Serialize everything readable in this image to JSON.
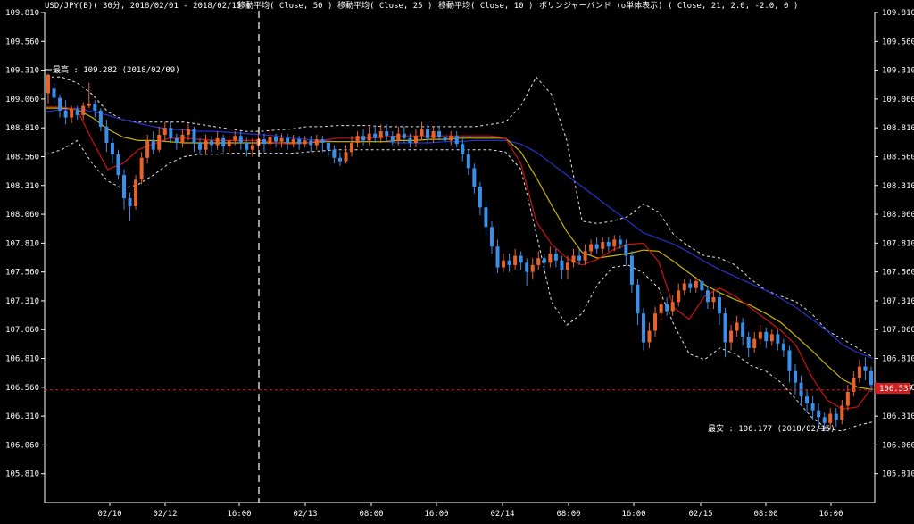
{
  "header": {
    "symbol": "USD/JPY(B)( 30分, 2018/02/01 - 2018/02/15 )",
    "ma50": "移動平均( Close, 50 )",
    "ma25": "移動平均( Close, 25 )",
    "ma10": "移動平均( Close, 10 )",
    "bb": "ボリンジャーバンド (σ単体表示) ( Close, 21, 2.0, -2.0, 0 )"
  },
  "annotations": {
    "high": "最高 : 109.282 (2018/02/09)",
    "low": "最安 : 106.177 (2018/02/15)",
    "current": "106.537"
  },
  "colors": {
    "up": "#e8632c",
    "down": "#3a8fe8",
    "ma50": "#2233cc",
    "ma25": "#c8b400",
    "ma10": "#cc1111",
    "band": "#e6e6e6",
    "grid": "#2a2a2a",
    "current_line": "#d02020"
  },
  "chart_data": {
    "type": "line",
    "title": "USD/JPY(B)( 30分, 2018/02/01 - 2018/02/15 )",
    "ylim": [
      105.56,
      109.81
    ],
    "y_ticks": [
      109.81,
      109.56,
      109.31,
      109.06,
      108.81,
      108.56,
      108.31,
      108.06,
      107.81,
      107.56,
      107.31,
      107.06,
      106.81,
      106.56,
      106.31,
      106.06,
      105.81
    ],
    "x_ticks": [
      "02/10",
      "02/12",
      "16:00",
      "02/13",
      "08:00",
      "16:00",
      "02/14",
      "08:00",
      "16:00",
      "02/15",
      "08:00",
      "16:00"
    ],
    "grid": true,
    "current_price": 106.537,
    "high": 109.282,
    "low": 106.177,
    "series": [
      {
        "name": "移動平均( Close, 50 )",
        "values": [
          108.95,
          108.97,
          108.98,
          108.95,
          108.92,
          108.88,
          108.85,
          108.82,
          108.8,
          108.79,
          108.78,
          108.78,
          108.77,
          108.76,
          108.75,
          108.74,
          108.72,
          108.71,
          108.7,
          108.69,
          108.69,
          108.69,
          108.69,
          108.68,
          108.68,
          108.68,
          108.69,
          108.69,
          108.7,
          108.7,
          108.7,
          108.67,
          108.6,
          108.5,
          108.4,
          108.3,
          108.2,
          108.1,
          108.0,
          107.9,
          107.85,
          107.8,
          107.73,
          107.65,
          107.58,
          107.52,
          107.46,
          107.4,
          107.33,
          107.25,
          107.15,
          107.05,
          106.93,
          106.86,
          106.81
        ]
      },
      {
        "name": "移動平均( Close, 25 )",
        "values": [
          108.98,
          108.98,
          108.97,
          108.9,
          108.8,
          108.73,
          108.7,
          108.7,
          108.69,
          108.68,
          108.68,
          108.68,
          108.68,
          108.68,
          108.68,
          108.68,
          108.68,
          108.68,
          108.69,
          108.69,
          108.69,
          108.69,
          108.69,
          108.7,
          108.7,
          108.71,
          108.71,
          108.72,
          108.72,
          108.72,
          108.72,
          108.6,
          108.38,
          108.14,
          107.91,
          107.73,
          107.68,
          107.7,
          107.72,
          107.75,
          107.74,
          107.65,
          107.55,
          107.45,
          107.38,
          107.32,
          107.27,
          107.2,
          107.12,
          107.0,
          106.88,
          106.75,
          106.63,
          106.56,
          106.54
        ]
      },
      {
        "name": "移動平均( Close, 10 )",
        "values": [
          108.99,
          108.99,
          108.97,
          108.7,
          108.45,
          108.5,
          108.62,
          108.67,
          108.72,
          108.72,
          108.71,
          108.7,
          108.7,
          108.7,
          108.7,
          108.68,
          108.67,
          108.68,
          108.7,
          108.72,
          108.72,
          108.72,
          108.73,
          108.74,
          108.74,
          108.74,
          108.74,
          108.74,
          108.74,
          108.74,
          108.72,
          108.5,
          108.0,
          107.8,
          107.68,
          107.62,
          107.67,
          107.75,
          107.8,
          107.81,
          107.65,
          107.25,
          107.15,
          107.35,
          107.42,
          107.35,
          107.25,
          107.15,
          107.05,
          106.92,
          106.65,
          106.45,
          106.37,
          106.39,
          106.57
        ]
      },
      {
        "name": "BB+2σ",
        "values": [
          109.25,
          109.25,
          109.2,
          109.1,
          108.95,
          108.88,
          108.86,
          108.86,
          108.86,
          108.86,
          108.84,
          108.82,
          108.8,
          108.78,
          108.78,
          108.79,
          108.8,
          108.82,
          108.82,
          108.83,
          108.83,
          108.83,
          108.82,
          108.82,
          108.82,
          108.82,
          108.82,
          108.82,
          108.82,
          108.84,
          108.86,
          109.0,
          109.25,
          109.1,
          108.7,
          108.0,
          107.98,
          108.0,
          108.04,
          108.15,
          108.08,
          107.88,
          107.78,
          107.7,
          107.68,
          107.62,
          107.5,
          107.4,
          107.35,
          107.3,
          107.2,
          107.05,
          106.98,
          106.9,
          106.82
        ]
      },
      {
        "name": "BB-2σ",
        "values": [
          108.58,
          108.62,
          108.7,
          108.5,
          108.35,
          108.28,
          108.32,
          108.4,
          108.5,
          108.56,
          108.58,
          108.58,
          108.59,
          108.59,
          108.59,
          108.59,
          108.59,
          108.6,
          108.61,
          108.62,
          108.62,
          108.62,
          108.62,
          108.62,
          108.62,
          108.62,
          108.62,
          108.62,
          108.62,
          108.62,
          108.6,
          108.45,
          107.9,
          107.3,
          107.1,
          107.2,
          107.45,
          107.6,
          107.62,
          107.55,
          107.42,
          107.1,
          106.85,
          106.8,
          106.9,
          106.85,
          106.75,
          106.7,
          106.6,
          106.45,
          106.3,
          106.2,
          106.18,
          106.23,
          106.26
        ]
      }
    ],
    "candles": [
      [
        109.11,
        109.27,
        109.28,
        109.02
      ],
      [
        109.15,
        109.07,
        109.2,
        109.02
      ],
      [
        109.07,
        108.96,
        109.1,
        108.9
      ],
      [
        108.96,
        108.9,
        109.05,
        108.84
      ],
      [
        108.9,
        108.97,
        109.0,
        108.85
      ],
      [
        108.97,
        108.92,
        109.0,
        108.88
      ],
      [
        108.92,
        109.0,
        109.03,
        108.88
      ],
      [
        109.0,
        109.02,
        109.2,
        108.98
      ],
      [
        109.02,
        108.96,
        109.05,
        108.9
      ],
      [
        108.96,
        108.82,
        108.98,
        108.78
      ],
      [
        108.82,
        108.68,
        108.88,
        108.6
      ],
      [
        108.68,
        108.58,
        108.72,
        108.5
      ],
      [
        108.58,
        108.4,
        108.62,
        108.36
      ],
      [
        108.4,
        108.2,
        108.45,
        108.1
      ],
      [
        108.2,
        108.13,
        108.25,
        108.0
      ],
      [
        108.13,
        108.36,
        108.4,
        108.1
      ],
      [
        108.36,
        108.55,
        108.6,
        108.32
      ],
      [
        108.55,
        108.7,
        108.75,
        108.5
      ],
      [
        108.7,
        108.62,
        108.78,
        108.58
      ],
      [
        108.62,
        108.75,
        108.82,
        108.6
      ],
      [
        108.75,
        108.81,
        108.86,
        108.7
      ],
      [
        108.81,
        108.72,
        108.86,
        108.68
      ],
      [
        108.72,
        108.68,
        108.76,
        108.62
      ],
      [
        108.68,
        108.75,
        108.8,
        108.64
      ],
      [
        108.75,
        108.8,
        108.85,
        108.7
      ],
      [
        108.8,
        108.68,
        108.82,
        108.6
      ],
      [
        108.68,
        108.62,
        108.72,
        108.58
      ],
      [
        108.62,
        108.7,
        108.75,
        108.58
      ],
      [
        108.7,
        108.66,
        108.74,
        108.6
      ],
      [
        108.66,
        108.72,
        108.78,
        108.62
      ],
      [
        108.72,
        108.65,
        108.75,
        108.6
      ],
      [
        108.65,
        108.7,
        108.74,
        108.6
      ],
      [
        108.7,
        108.74,
        108.78,
        108.66
      ],
      [
        108.74,
        108.68,
        108.78,
        108.62
      ],
      [
        108.68,
        108.62,
        108.72,
        108.56
      ],
      [
        108.62,
        108.66,
        108.72,
        108.56
      ],
      [
        108.66,
        108.71,
        108.76,
        108.62
      ],
      [
        108.71,
        108.67,
        108.76,
        108.6
      ],
      [
        108.67,
        108.73,
        108.78,
        108.62
      ],
      [
        108.73,
        108.69,
        108.76,
        108.64
      ],
      [
        108.69,
        108.72,
        108.76,
        108.64
      ],
      [
        108.72,
        108.68,
        108.76,
        108.62
      ],
      [
        108.68,
        108.71,
        108.75,
        108.64
      ],
      [
        108.71,
        108.67,
        108.74,
        108.62
      ],
      [
        108.67,
        108.7,
        108.74,
        108.64
      ],
      [
        108.7,
        108.66,
        108.74,
        108.6
      ],
      [
        108.66,
        108.71,
        108.75,
        108.62
      ],
      [
        108.71,
        108.68,
        108.74,
        108.6
      ],
      [
        108.68,
        108.62,
        108.7,
        108.56
      ],
      [
        108.62,
        108.55,
        108.66,
        108.5
      ],
      [
        108.55,
        108.52,
        108.6,
        108.48
      ],
      [
        108.52,
        108.6,
        108.66,
        108.5
      ],
      [
        108.6,
        108.68,
        108.74,
        108.56
      ],
      [
        108.68,
        108.74,
        108.78,
        108.64
      ],
      [
        108.74,
        108.7,
        108.8,
        108.66
      ],
      [
        108.7,
        108.76,
        108.82,
        108.66
      ],
      [
        108.76,
        108.72,
        108.82,
        108.68
      ],
      [
        108.72,
        108.78,
        108.84,
        108.68
      ],
      [
        108.78,
        108.74,
        108.84,
        108.7
      ],
      [
        108.74,
        108.7,
        108.78,
        108.66
      ],
      [
        108.7,
        108.76,
        108.82,
        108.66
      ],
      [
        108.76,
        108.72,
        108.82,
        108.68
      ],
      [
        108.72,
        108.68,
        108.76,
        108.64
      ],
      [
        108.68,
        108.74,
        108.8,
        108.64
      ],
      [
        108.74,
        108.8,
        108.86,
        108.7
      ],
      [
        108.8,
        108.72,
        108.84,
        108.68
      ],
      [
        108.72,
        108.78,
        108.82,
        108.68
      ],
      [
        108.78,
        108.73,
        108.82,
        108.7
      ],
      [
        108.73,
        108.7,
        108.76,
        108.66
      ],
      [
        108.7,
        108.74,
        108.78,
        108.66
      ],
      [
        108.74,
        108.67,
        108.78,
        108.64
      ],
      [
        108.67,
        108.58,
        108.72,
        108.52
      ],
      [
        108.58,
        108.46,
        108.62,
        108.4
      ],
      [
        108.46,
        108.3,
        108.5,
        108.24
      ],
      [
        108.3,
        108.12,
        108.34,
        108.05
      ],
      [
        108.12,
        107.95,
        108.18,
        107.88
      ],
      [
        107.95,
        107.78,
        108.0,
        107.72
      ],
      [
        107.78,
        107.6,
        107.84,
        107.55
      ],
      [
        107.6,
        107.66,
        107.72,
        107.56
      ],
      [
        107.66,
        107.62,
        107.72,
        107.56
      ],
      [
        107.62,
        107.7,
        107.76,
        107.58
      ],
      [
        107.7,
        107.64,
        107.74,
        107.58
      ],
      [
        107.64,
        107.56,
        107.68,
        107.44
      ],
      [
        107.56,
        107.62,
        107.68,
        107.5
      ],
      [
        107.62,
        107.68,
        107.74,
        107.58
      ],
      [
        107.68,
        107.64,
        107.72,
        107.58
      ],
      [
        107.64,
        107.72,
        107.78,
        107.6
      ],
      [
        107.72,
        107.66,
        107.76,
        107.6
      ],
      [
        107.66,
        107.58,
        107.7,
        107.5
      ],
      [
        107.58,
        107.64,
        107.7,
        107.5
      ],
      [
        107.64,
        107.7,
        107.76,
        107.6
      ],
      [
        107.7,
        107.66,
        107.76,
        107.62
      ],
      [
        107.66,
        107.74,
        107.8,
        107.62
      ],
      [
        107.74,
        107.8,
        107.84,
        107.7
      ],
      [
        107.8,
        107.76,
        107.86,
        107.72
      ],
      [
        107.76,
        107.82,
        107.86,
        107.72
      ],
      [
        107.82,
        107.78,
        107.86,
        107.74
      ],
      [
        107.78,
        107.84,
        107.88,
        107.74
      ],
      [
        107.84,
        107.8,
        107.88,
        107.76
      ],
      [
        107.8,
        107.7,
        107.84,
        107.62
      ],
      [
        107.7,
        107.45,
        107.74,
        107.38
      ],
      [
        107.45,
        107.2,
        107.5,
        107.1
      ],
      [
        107.2,
        106.95,
        107.25,
        106.88
      ],
      [
        106.95,
        107.05,
        107.12,
        106.9
      ],
      [
        107.05,
        107.2,
        107.26,
        107.0
      ],
      [
        107.2,
        107.28,
        107.34,
        107.14
      ],
      [
        107.28,
        107.22,
        107.34,
        107.18
      ],
      [
        107.22,
        107.3,
        107.36,
        107.18
      ],
      [
        107.3,
        107.4,
        107.46,
        107.26
      ],
      [
        107.4,
        107.46,
        107.5,
        107.36
      ],
      [
        107.46,
        107.42,
        107.5,
        107.38
      ],
      [
        107.42,
        107.48,
        107.52,
        107.38
      ],
      [
        107.48,
        107.4,
        107.52,
        107.34
      ],
      [
        107.4,
        107.3,
        107.44,
        107.24
      ],
      [
        107.3,
        107.34,
        107.4,
        107.24
      ],
      [
        107.34,
        107.2,
        107.38,
        107.1
      ],
      [
        107.2,
        106.95,
        107.25,
        106.82
      ],
      [
        106.95,
        107.05,
        107.1,
        106.88
      ],
      [
        107.05,
        107.12,
        107.18,
        107.0
      ],
      [
        107.12,
        107.0,
        107.16,
        106.92
      ],
      [
        107.0,
        106.9,
        107.04,
        106.82
      ],
      [
        106.9,
        106.98,
        107.04,
        106.86
      ],
      [
        106.98,
        107.04,
        107.1,
        106.94
      ],
      [
        107.04,
        106.96,
        107.08,
        106.9
      ],
      [
        106.96,
        107.02,
        107.06,
        106.92
      ],
      [
        107.02,
        106.94,
        107.06,
        106.88
      ],
      [
        106.94,
        106.88,
        106.98,
        106.82
      ],
      [
        106.88,
        106.7,
        106.92,
        106.6
      ],
      [
        106.7,
        106.6,
        106.76,
        106.5
      ],
      [
        106.6,
        106.48,
        106.66,
        106.4
      ],
      [
        106.48,
        106.42,
        106.54,
        106.34
      ],
      [
        106.42,
        106.36,
        106.48,
        106.28
      ],
      [
        106.36,
        106.3,
        106.42,
        106.22
      ],
      [
        106.3,
        106.25,
        106.34,
        106.18
      ],
      [
        106.25,
        106.33,
        106.38,
        106.2
      ],
      [
        106.33,
        106.28,
        106.38,
        106.22
      ],
      [
        106.28,
        106.4,
        106.45,
        106.24
      ],
      [
        106.4,
        106.52,
        106.58,
        106.36
      ],
      [
        106.52,
        106.64,
        106.7,
        106.48
      ],
      [
        106.64,
        106.74,
        106.8,
        106.6
      ],
      [
        106.74,
        106.7,
        106.82,
        106.62
      ],
      [
        106.7,
        106.58,
        106.74,
        106.52
      ]
    ]
  }
}
